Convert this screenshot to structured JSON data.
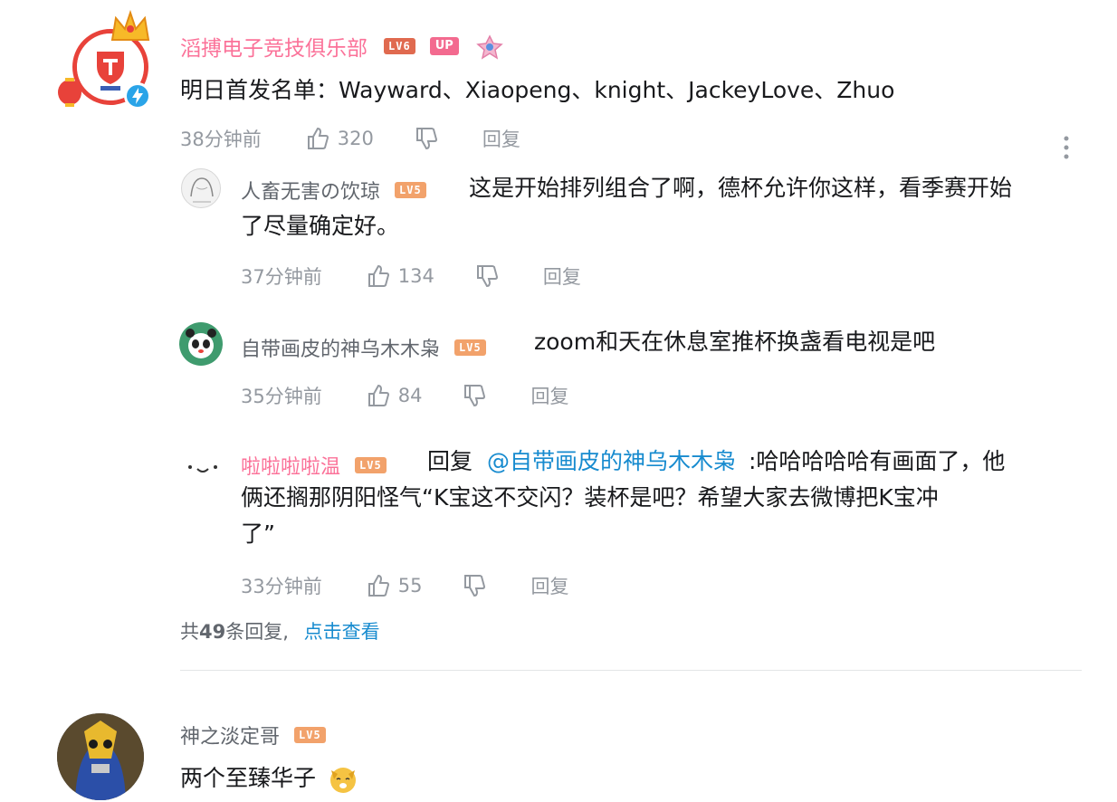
{
  "main_comment": {
    "username": "滔搏电子竞技俱乐部",
    "level": "LV6",
    "up_badge": "UP",
    "content": "明日首发名单：Wayward、Xiaopeng、knight、JackeyLove、Zhuo",
    "time": "38分钟前",
    "likes": "320",
    "reply_label": "回复"
  },
  "replies": [
    {
      "username": "人畜无害の饮琼",
      "level": "LV5",
      "content_line1": "这是开始排列组合了啊，德杯允许你这样，看季赛开始",
      "content_line2": "了尽量确定好。",
      "time": "37分钟前",
      "likes": "134",
      "reply_label": "回复"
    },
    {
      "username": "自带画皮的神乌木木枭",
      "level": "LV5",
      "content": "zoom和天在休息室推杯换盏看电视是吧",
      "time": "35分钟前",
      "likes": "84",
      "reply_label": "回复"
    },
    {
      "username": "啦啦啦啦温",
      "level": "LV5",
      "reply_prefix": "回复",
      "mention": "@自带画皮的神乌木木枭",
      "content_line1": ":哈哈哈哈哈有画面了，他",
      "content_line2": "俩还搁那阴阳怪气“K宝这不交闪？装杯是吧？希望大家去微博把K宝冲",
      "content_line3": "了”",
      "time": "33分钟前",
      "likes": "55",
      "reply_label": "回复"
    }
  ],
  "reply_summary": {
    "prefix": "共",
    "count": "49",
    "suffix": "条回复,",
    "link": "点击查看"
  },
  "next_comment": {
    "username": "神之淡定哥",
    "level": "LV5",
    "content": "两个至臻华子"
  },
  "colors": {
    "vip_name": "#fb7299",
    "link": "#178bcf",
    "meta_gray": "#9499a0",
    "level_lv5": "#f2a26b",
    "level_lv6": "#e06a4f"
  },
  "icons": [
    "verified-icon",
    "like-icon",
    "dislike-icon",
    "more-icon",
    "crown-frame-icon",
    "dog-emoji-icon"
  ]
}
